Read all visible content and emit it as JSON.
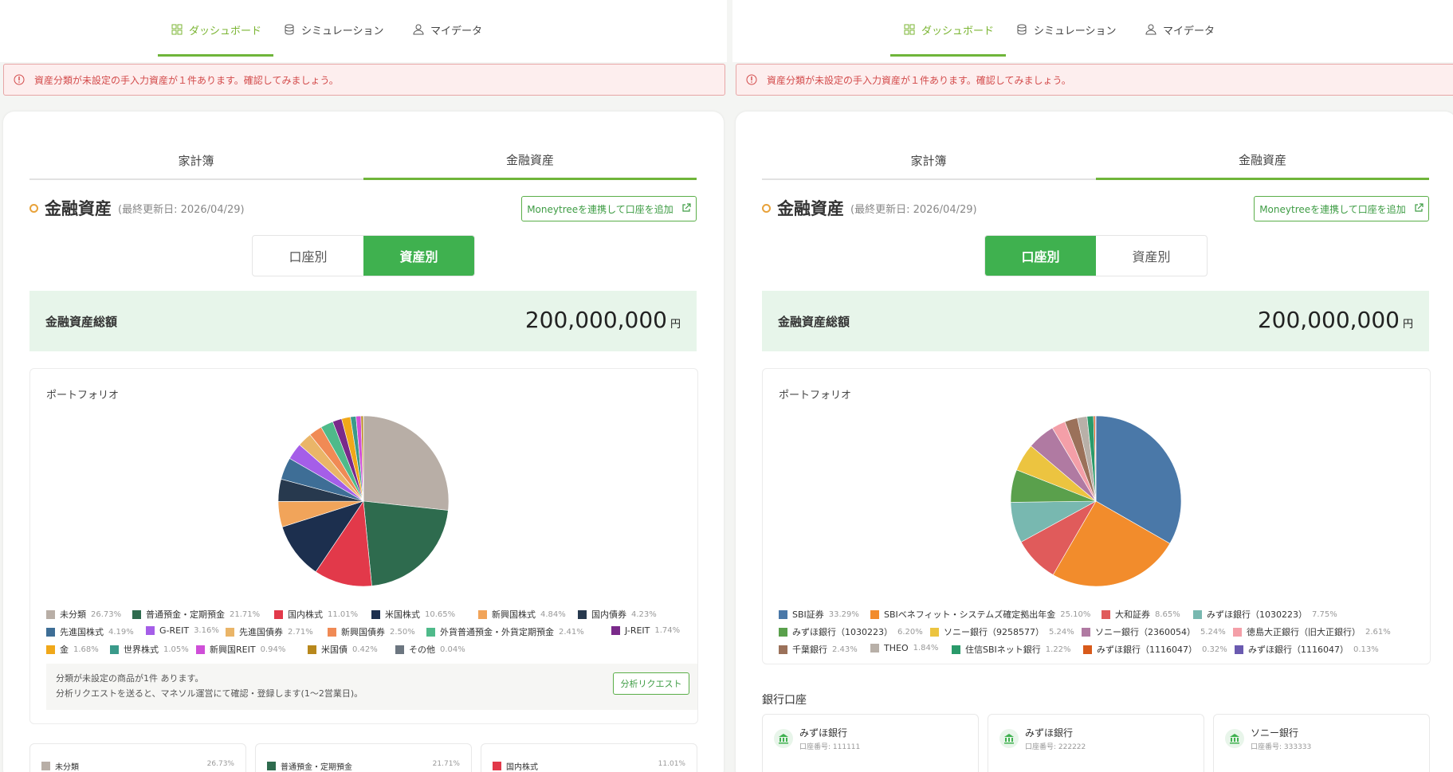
{
  "nav": {
    "items": [
      "ダッシュボード",
      "シミュレーション",
      "マイデータ"
    ],
    "active": 0
  },
  "alert": {
    "text": "資産分類が未設定の手入力資産が１件あります。確認してみましょう。"
  },
  "tabs": [
    "家計簿",
    "金融資産"
  ],
  "section": {
    "title": "金融資産",
    "updated": "(最終更新日: 2026/04/29)",
    "moneytree_button": "Moneytreeを連携して口座を追加"
  },
  "segment": {
    "by_account": "口座別",
    "by_asset": "資産別"
  },
  "total": {
    "label": "金融資産総額",
    "value": "200,000,000",
    "unit": "円"
  },
  "portfolio_title": "ポートフォリオ",
  "left": {
    "selected_segment": "資産別",
    "note_line1": "分類が未設定の商品が1件 あります。",
    "note_line2": "分析リクエストを送ると、マネソル運営にて確認・登録します(1〜2営業日)。",
    "request_button": "分析リクエスト",
    "bottom_cards": [
      {
        "label": "未分類",
        "pct": "26.73%",
        "color": "#b8aea6"
      },
      {
        "label": "普通預金・定期預金",
        "pct": "21.71%",
        "color": "#2e6b4e"
      },
      {
        "label": "国内株式",
        "pct": "11.01%",
        "color": "#e2394a"
      }
    ]
  },
  "right": {
    "selected_segment": "口座別",
    "bank_section_title": "銀行口座",
    "banks": [
      {
        "name": "みずほ銀行",
        "number": "口座番号: 111111"
      },
      {
        "name": "みずほ銀行",
        "number": "口座番号: 222222"
      },
      {
        "name": "ソニー銀行",
        "number": "口座番号: 333333"
      }
    ]
  },
  "chart_data": [
    {
      "type": "pie",
      "title": "ポートフォリオ",
      "categories": [
        "未分類",
        "普通預金・定期預金",
        "国内株式",
        "米国株式",
        "新興国株式",
        "国内債券",
        "先進国株式",
        "G-REIT",
        "先進国債券",
        "新興国債券",
        "外貨普通預金・外貨定期預金",
        "J-REIT",
        "金",
        "世界株式",
        "新興国REIT",
        "米国債",
        "その他"
      ],
      "values": [
        26.73,
        21.71,
        11.01,
        10.65,
        4.84,
        4.23,
        4.19,
        3.16,
        2.71,
        2.5,
        2.41,
        1.74,
        1.68,
        1.05,
        0.94,
        0.42,
        0.04
      ],
      "labels": [
        "26.73%",
        "21.71%",
        "11.01%",
        "10.65%",
        "4.84%",
        "4.23%",
        "4.19%",
        "3.16%",
        "2.71%",
        "2.50%",
        "2.41%",
        "1.74%",
        "1.68%",
        "1.05%",
        "0.94%",
        "0.42%",
        "0.04%"
      ],
      "colors": [
        "#b8aea6",
        "#2e6b4e",
        "#e2394a",
        "#1c2f4e",
        "#f1a45a",
        "#27394e",
        "#3e6e96",
        "#a55ee8",
        "#eab568",
        "#f08a55",
        "#4fba8a",
        "#7a2a8a",
        "#f0a81a",
        "#3a9a8a",
        "#cf4fd8",
        "#b8881c",
        "#6c7680"
      ]
    },
    {
      "type": "pie",
      "title": "ポートフォリオ",
      "categories": [
        "SBI証券",
        "SBIベネフィット・システムズ確定拠出年金",
        "大和証券",
        "みずほ銀行（1030223）",
        "みずほ銀行（1030223）",
        "ソニー銀行（9258577）",
        "ソニー銀行（2360054）",
        "徳島大正銀行（旧大正銀行）",
        "千葉銀行",
        "THEO",
        "住信SBIネット銀行",
        "みずほ銀行（1116047）",
        "みずほ銀行（1116047）"
      ],
      "values": [
        33.29,
        25.1,
        8.65,
        7.75,
        6.2,
        5.24,
        5.24,
        2.61,
        2.43,
        1.84,
        1.22,
        0.32,
        0.13
      ],
      "labels": [
        "33.29%",
        "25.10%",
        "8.65%",
        "7.75%",
        "6.20%",
        "5.24%",
        "5.24%",
        "2.61%",
        "2.43%",
        "1.84%",
        "1.22%",
        "0.32%",
        "0.13%"
      ],
      "colors": [
        "#4a78a8",
        "#f28c2c",
        "#e05b5b",
        "#78b8b0",
        "#5aa04c",
        "#ecc440",
        "#b07aa2",
        "#f49fa8",
        "#9b715a",
        "#b8b0a8",
        "#2a9a6a",
        "#d85a1a",
        "#6a5ab0"
      ]
    }
  ]
}
